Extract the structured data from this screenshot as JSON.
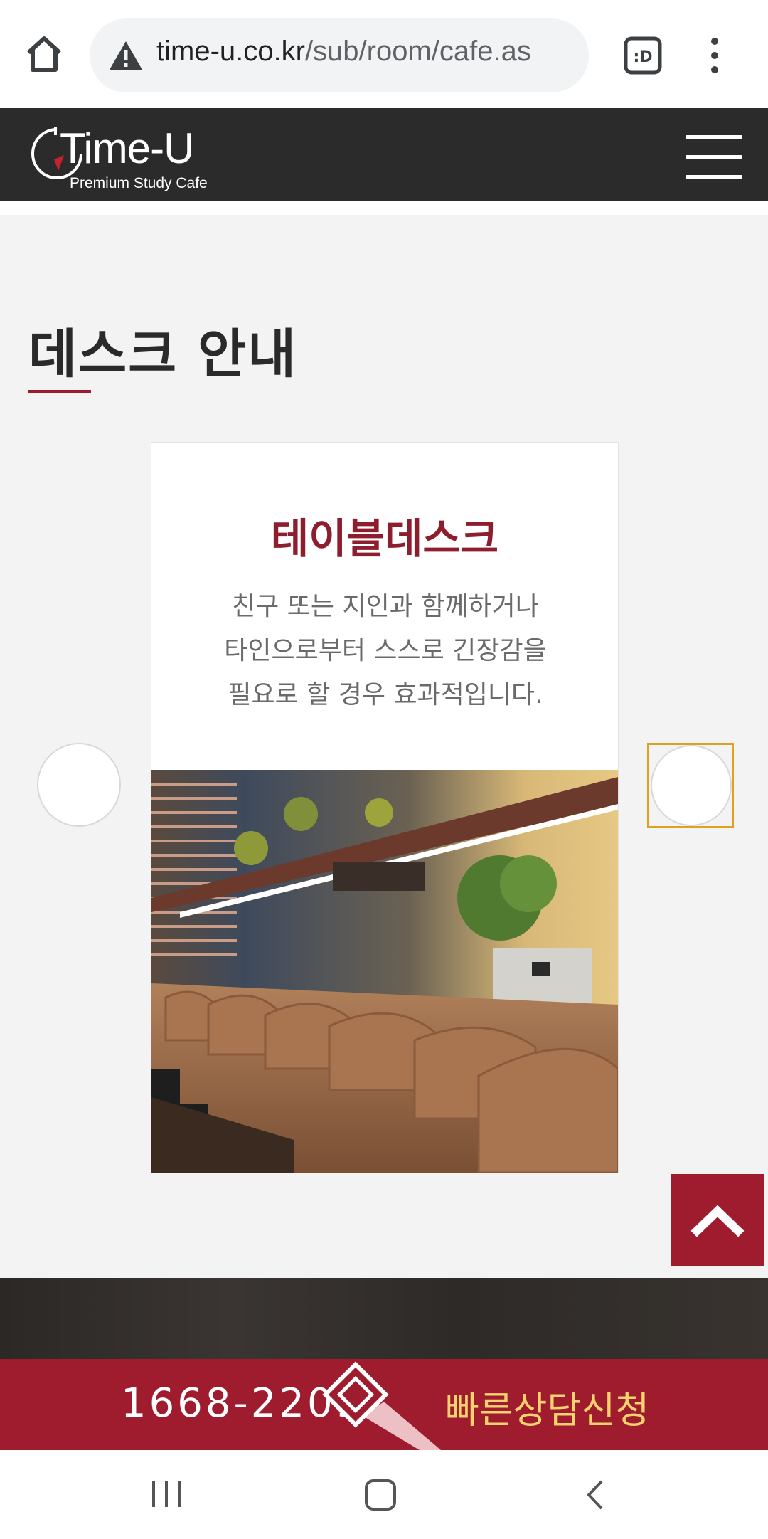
{
  "browser": {
    "url_domain": "time-u.co.kr",
    "url_path": "/sub/room/cafe.as",
    "tab_label": ":D"
  },
  "site": {
    "logo_main": "Time-U",
    "logo_sub": "Premium Study Cafe"
  },
  "section": {
    "title": "데스크 안내"
  },
  "card": {
    "title": "테이블데스크",
    "desc_line1": "친구 또는 지인과 함께하거나",
    "desc_line2": "타인으로부터 스스로 긴장감을",
    "desc_line3": "필요로 할 경우 효과적입니다."
  },
  "cta": {
    "phone": "1668-2209",
    "label": "빠른상담신청"
  },
  "colors": {
    "brand_red": "#9e1c2d",
    "title_red": "#8e1e2e",
    "cta_text": "#f7d26e",
    "header_bg": "#2b2b2b"
  }
}
